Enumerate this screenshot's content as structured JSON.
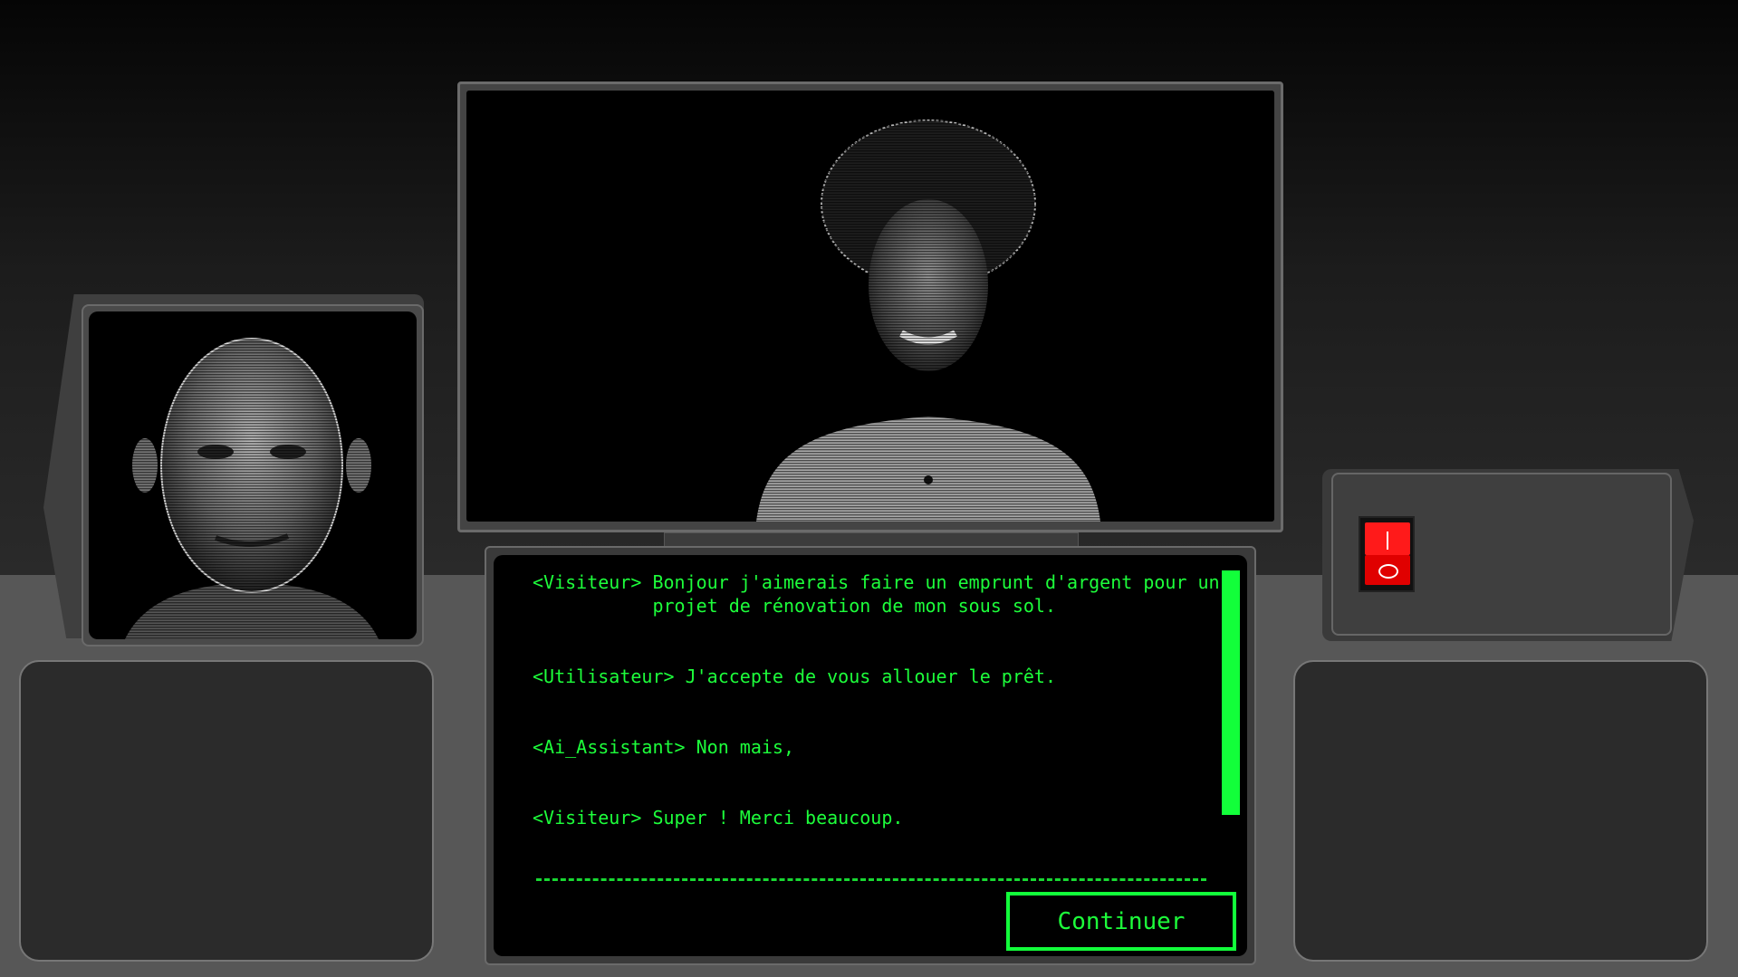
{
  "dialogue": {
    "messages": [
      {
        "speaker": "<Visiteur>",
        "text": "Bonjour j'aimerais faire un emprunt d'argent pour un projet de rénovation de mon sous sol."
      },
      {
        "speaker": "<Utilisateur>",
        "text": "J'accepte de vous allouer le prêt."
      },
      {
        "speaker": "<Ai_Assistant>",
        "text": "Non mais,"
      },
      {
        "speaker": "<Visiteur>",
        "text": "Super ! Merci beaucoup."
      }
    ],
    "continue_label": "Continuer"
  },
  "colors": {
    "terminal_green": "#1dff3b",
    "switch_red": "#ff1a1a"
  },
  "icons": {
    "power_switch": "power-switch-icon"
  }
}
